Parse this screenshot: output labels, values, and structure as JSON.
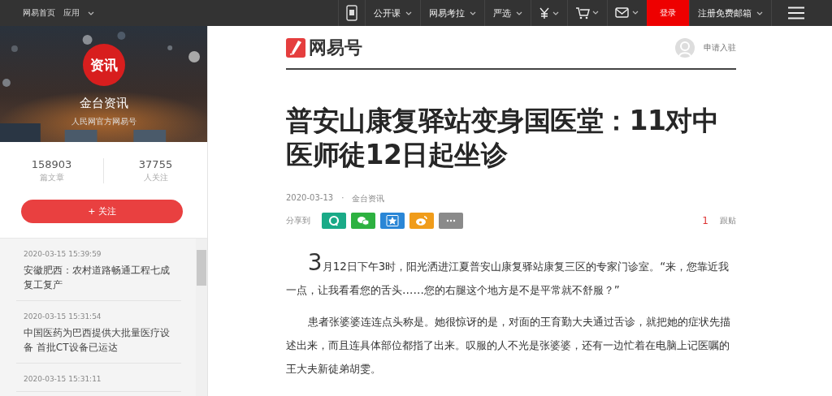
{
  "top_nav": {
    "left": [
      {
        "label": "网易首页",
        "dropdown": false
      },
      {
        "label": "应用",
        "dropdown": true
      }
    ],
    "right": [
      {
        "kind": "phone"
      },
      {
        "kind": "text",
        "label": "公开课"
      },
      {
        "kind": "text",
        "label": "网易考拉"
      },
      {
        "kind": "text",
        "label": "严选"
      },
      {
        "kind": "yen"
      },
      {
        "kind": "cart"
      },
      {
        "kind": "mail"
      },
      {
        "kind": "login",
        "label": "登录"
      },
      {
        "kind": "text",
        "label": "注册免费邮箱"
      },
      {
        "kind": "menu"
      }
    ]
  },
  "profile": {
    "avatar_text": "资讯",
    "name": "金台资讯",
    "subtitle": "人民网官方网易号",
    "stats": [
      {
        "value": "158903",
        "label": "篇文章"
      },
      {
        "value": "37755",
        "label": "人关注"
      }
    ],
    "follow_button": "+ 关注"
  },
  "news": [
    {
      "time": "2020-03-15 15:39:59",
      "title": "安徽肥西：农村道路畅通工程七成复工复产"
    },
    {
      "time": "2020-03-15 15:31:54",
      "title": "中国医药为巴西提供大批量医疗设备 首批CT设备已运达"
    },
    {
      "time": "2020-03-15 15:31:11"
    }
  ],
  "brand": {
    "logo_text": "网易号",
    "apply": "申请入驻"
  },
  "article": {
    "title": "普安山康复驿站变身国医堂：11对中医师徒12日起坐诊",
    "date": "2020-03-13",
    "separator": "·",
    "source": "金台资讯",
    "share_label": "分享到",
    "share": [
      {
        "kind": "qq",
        "color": "#1aaa87"
      },
      {
        "kind": "wechat",
        "color": "#2db140"
      },
      {
        "kind": "star",
        "color": "#2a86d6"
      },
      {
        "kind": "weibo",
        "color": "#f09c1a"
      },
      {
        "kind": "more",
        "color": "#8a8a8a"
      }
    ],
    "comments": "1",
    "comments_label": "跟贴",
    "paragraphs": [
      {
        "drop_cap": "3",
        "text": "月12日下午3时，阳光洒进江夏普安山康复驿站康复三区的专家门诊室。“来，您靠近我一点，让我看看您的舌头……您的右腿这个地方是不是平常就不舒服？”"
      },
      {
        "text": "患者张婆婆连连点头称是。她很惊讶的是，对面的王育勤大夫通过舌诊，就把她的症状先描述出来，而且连具体部位都指了出来。叹服的人不光是张婆婆，还有一边忙着在电脑上记医嘱的王大夫新徒弟胡雯。"
      }
    ]
  }
}
